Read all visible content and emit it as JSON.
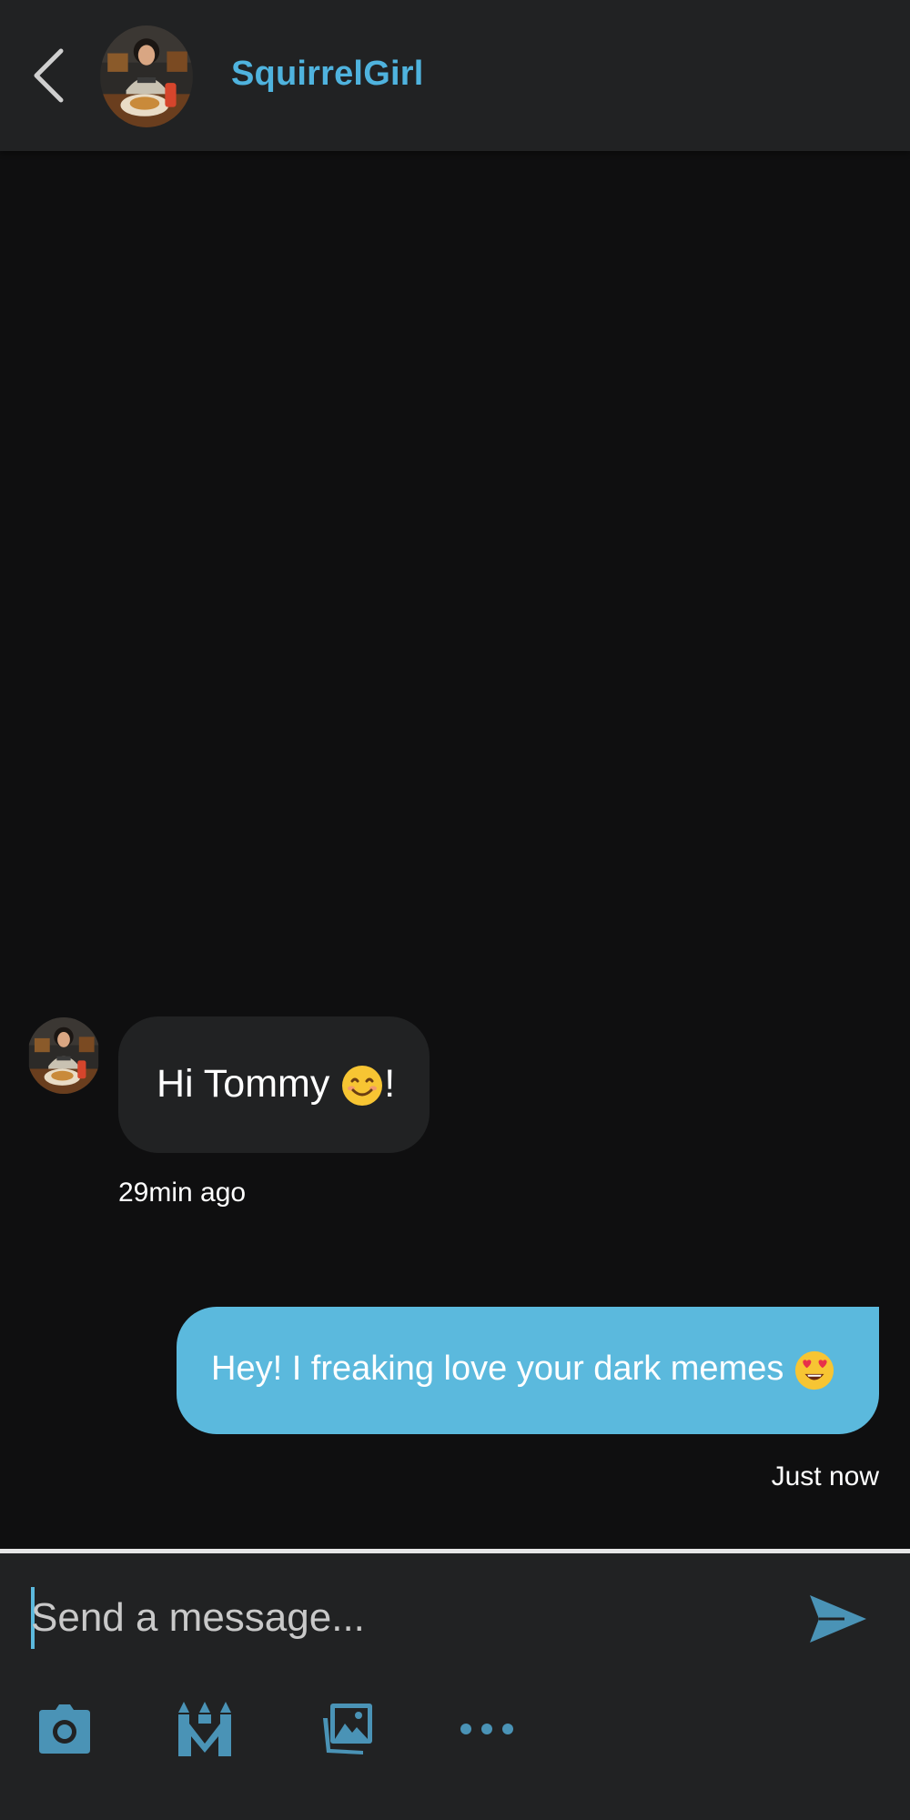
{
  "header": {
    "contact_name": "SquirrelGirl",
    "back_icon": "chevron-left-icon",
    "avatar": "contact-avatar"
  },
  "messages": [
    {
      "direction": "incoming",
      "text": "Hi Tommy ",
      "emoji": "smiling-face",
      "suffix": "!",
      "timestamp": "29min ago"
    },
    {
      "direction": "outgoing",
      "text": "Hey! I freaking love your dark memes ",
      "emoji": "heart-eyes-face",
      "timestamp": "Just now"
    }
  ],
  "composer": {
    "placeholder": "Send a message...",
    "value": "",
    "send_icon": "send-icon",
    "tools": [
      "camera-icon",
      "meme-crown-icon",
      "gallery-icon",
      "more-icon"
    ]
  },
  "colors": {
    "accent": "#5bb9dd",
    "name_color": "#4fb3de",
    "background": "#0f0f10",
    "bar": "#212223",
    "icon": "#4a93b6"
  }
}
